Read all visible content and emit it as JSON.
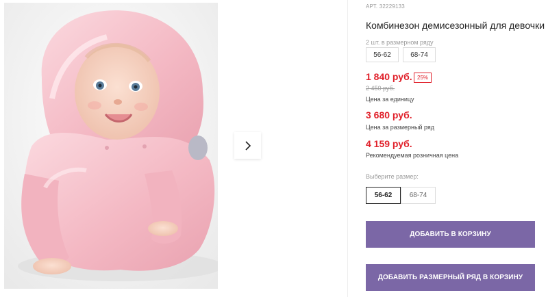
{
  "product": {
    "article": "АРТ. 32229133",
    "title": "Комбинезон демисезонный для девочки"
  },
  "series": {
    "note": "2 шт. в размерном ряду",
    "sizes": [
      "56-62",
      "68-74"
    ]
  },
  "prices": {
    "unit_price": "1 840 руб.",
    "discount": "25%",
    "old_price": "2 450 руб.",
    "unit_caption": "Цена за единицу",
    "series_price": "3 680 руб.",
    "series_caption": "Цена за размерный ряд",
    "retail_price": "4 159 руб.",
    "retail_caption": "Рекомендуемая розничная цена"
  },
  "size_selector": {
    "label": "Выберите размер:",
    "options": [
      "56-62",
      "68-74"
    ],
    "selected": "56-62"
  },
  "buttons": {
    "add_to_cart": "Добавить в корзину",
    "add_series_to_cart": "Добавить размерный ряд в корзину"
  },
  "gallery": {
    "next_icon": "chevron-right-icon"
  },
  "colors": {
    "accent_price": "#e0202a",
    "button_bg": "#7b67a6"
  }
}
